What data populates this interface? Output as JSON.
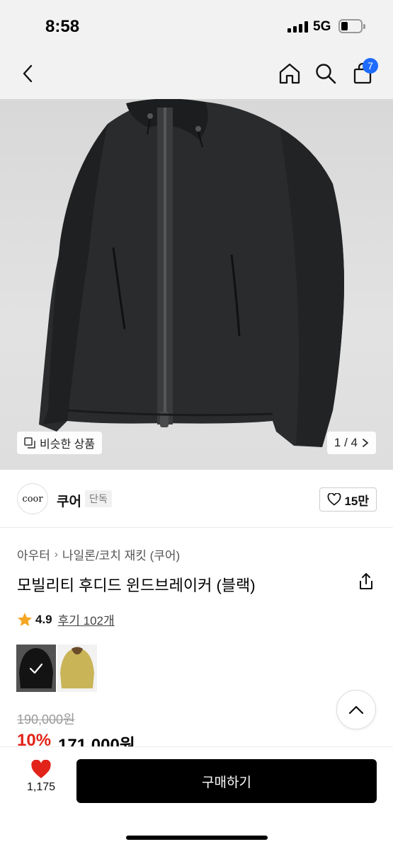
{
  "status_bar": {
    "time": "8:58",
    "network": "5G",
    "battery_level": 0.25
  },
  "nav": {
    "back_icon": "chevron-left-icon",
    "home_icon": "home-icon",
    "search_icon": "search-icon",
    "cart_icon": "shopping-bag-icon",
    "cart_badge": "7",
    "badge_color": "#1f6bff"
  },
  "gallery": {
    "similar_label": "비슷한 상품",
    "pager": "1 / 4"
  },
  "brand": {
    "logo_text": "coor",
    "name": "쿠어",
    "tag": "단독",
    "likes": "15만"
  },
  "breadcrumb": {
    "items": [
      "아우터",
      "나일론/코치 재킷 (쿠어)"
    ]
  },
  "product": {
    "title": "모빌리티 후디드 윈드브레이커 (블랙)",
    "rating": "4.9",
    "review_link": "후기 102개",
    "original_price": "190,000원",
    "discount": "10%",
    "sale_price": "171,000원",
    "discount_color": "#e2231a",
    "swatches": [
      "black",
      "yellow"
    ]
  },
  "bottom_bar": {
    "wish_count": "1,175",
    "buy_label": "구매하기",
    "wish_color": "#e2231a"
  }
}
